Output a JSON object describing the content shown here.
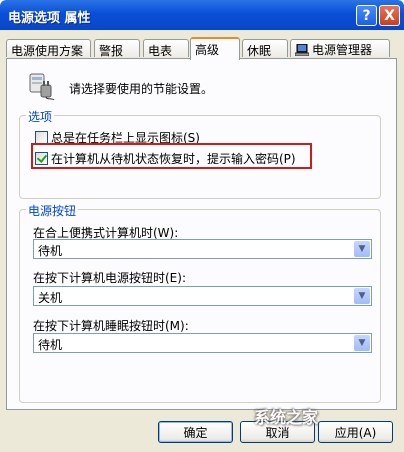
{
  "window": {
    "title": "电源选项 属性"
  },
  "titlebar_buttons": {
    "help": "?",
    "close": "X"
  },
  "tabs": [
    {
      "label": "电源使用方案"
    },
    {
      "label": "警报"
    },
    {
      "label": "电表"
    },
    {
      "label": "高级",
      "active": true
    },
    {
      "label": "休眠"
    },
    {
      "label": "电源管理器",
      "icon": "laptop-icon"
    }
  ],
  "intro": {
    "text": "请选择要使用的节能设置。",
    "icon": "power-plug-computer-icon"
  },
  "options": {
    "group_label": "选项",
    "show_icon": {
      "label": "总是在任务栏上显示图标(S)",
      "checked": false
    },
    "prompt_password": {
      "label": "在计算机从待机状态恢复时，提示输入密码(P)",
      "checked": true
    }
  },
  "power_buttons": {
    "group_label": "电源按钮",
    "lid": {
      "label": "在合上便携式计算机时(W):",
      "value": "待机"
    },
    "power": {
      "label": "在按下计算机电源按钮时(E):",
      "value": "关机"
    },
    "sleep": {
      "label": "在按下计算机睡眠按钮时(M):",
      "value": "待机"
    }
  },
  "buttons": {
    "ok": "确定",
    "cancel": "取消",
    "apply": "应用(A)"
  },
  "watermark": "系统之家"
}
